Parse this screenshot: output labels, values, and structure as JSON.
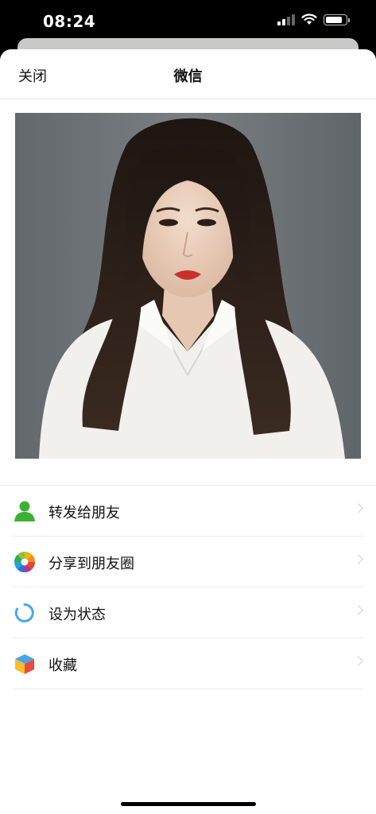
{
  "status_bar": {
    "time": "08:24",
    "icons": [
      "signal-icon",
      "wifi-icon",
      "battery-icon"
    ]
  },
  "nav": {
    "close_label": "关闭",
    "title": "微信"
  },
  "photo": {
    "icon": "portrait-photo"
  },
  "menu": {
    "items": [
      {
        "label": "转发给朋友",
        "icon": "contact-person-icon"
      },
      {
        "label": "分享到朋友圈",
        "icon": "moments-aperture-icon"
      },
      {
        "label": "设为状态",
        "icon": "status-ring-icon"
      },
      {
        "label": "收藏",
        "icon": "favorites-cube-icon"
      }
    ]
  },
  "colors": {
    "contact_green": "#3cb035",
    "status_blue": "#4aa5ee",
    "background": "#ffffff",
    "chevron": "#cfcfcf"
  }
}
